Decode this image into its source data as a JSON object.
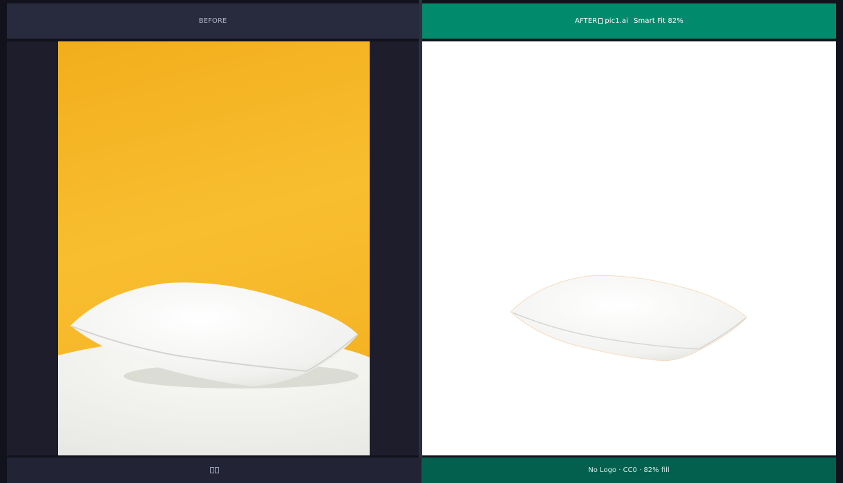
{
  "before": {
    "header_label": "BEFORE",
    "footer_icons": [
      "missing-glyph-icon",
      "missing-glyph-icon"
    ]
  },
  "after": {
    "header_prefix": "AFTER",
    "header_icon": "missing-glyph-icon",
    "header_brand": "pic1.ai",
    "header_mode": "Smart Fit 82%",
    "footer_text": "No Logo · CC0 · 82% fill"
  },
  "colors": {
    "background": "#12121c",
    "before_header": "#282a3e",
    "after_header": "#028a6c",
    "after_footer": "#03604e",
    "photo_backdrop": "#f6b728",
    "result_background": "#ffffff"
  }
}
